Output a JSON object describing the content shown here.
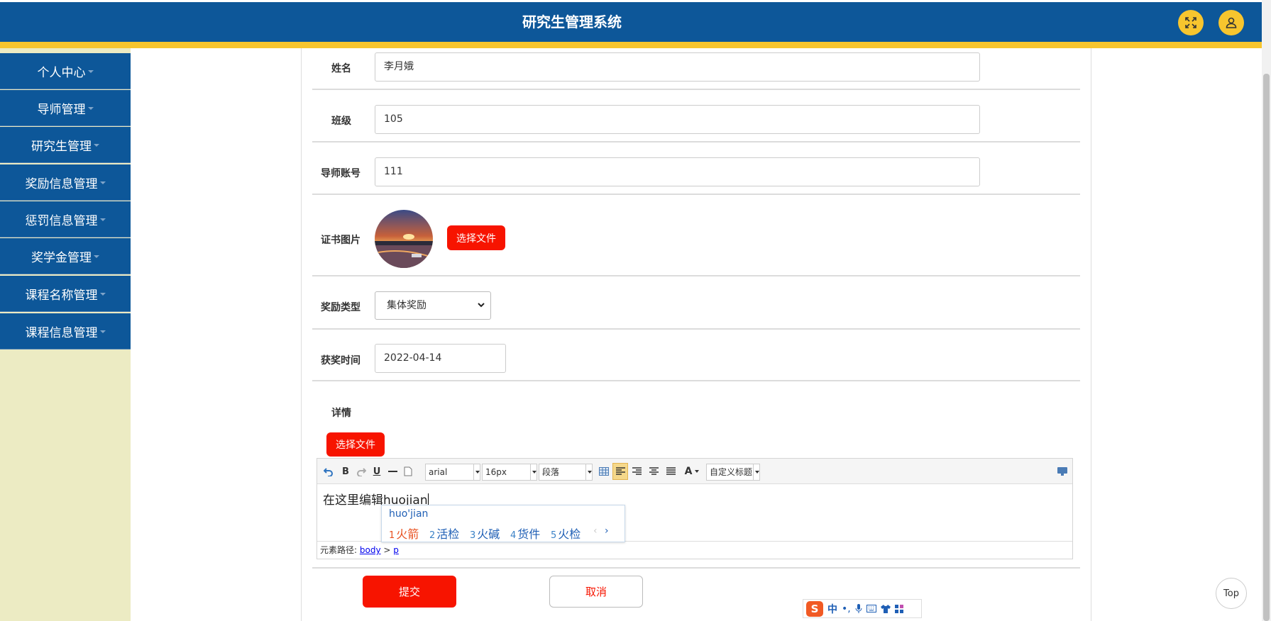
{
  "header": {
    "title": "研究生管理系统"
  },
  "sidebar": {
    "items": [
      {
        "label": "个人中心"
      },
      {
        "label": "导师管理"
      },
      {
        "label": "研究生管理"
      },
      {
        "label": "奖励信息管理"
      },
      {
        "label": "惩罚信息管理"
      },
      {
        "label": "奖学金管理"
      },
      {
        "label": "课程名称管理"
      },
      {
        "label": "课程信息管理"
      }
    ]
  },
  "form": {
    "name": {
      "label": "姓名",
      "value": "李月娥"
    },
    "class": {
      "label": "班级",
      "value": "105"
    },
    "tutor_account": {
      "label": "导师账号",
      "value": "111"
    },
    "certificate": {
      "label": "证书图片",
      "button": "选择文件"
    },
    "reward_type": {
      "label": "奖励类型",
      "value": "集体奖励"
    },
    "award_time": {
      "label": "获奖时间",
      "value": "2022-04-14"
    },
    "details": {
      "label": "详情",
      "button": "选择文件"
    },
    "submit": "提交",
    "cancel": "取消"
  },
  "editor": {
    "font_family": "arial",
    "font_size": "16px",
    "paragraph": "段落",
    "custom_title": "自定义标题",
    "content": "在这里编辑huojian",
    "path_label": "元素路径:",
    "path_body": "body",
    "path_sep": ">",
    "path_p": "p"
  },
  "ime": {
    "composition": "huo'jian",
    "candidates": [
      {
        "n": "1",
        "text": "火箭"
      },
      {
        "n": "2",
        "text": "活检"
      },
      {
        "n": "3",
        "text": "火碱"
      },
      {
        "n": "4",
        "text": "货件"
      },
      {
        "n": "5",
        "text": "火检"
      }
    ],
    "bar_lang": "中"
  },
  "top_button": "Top",
  "colors": {
    "header_blue": "#0d5799",
    "accent_yellow": "#f7c52e",
    "button_red": "#f71400",
    "sidebar_bg": "#ecebc3"
  }
}
